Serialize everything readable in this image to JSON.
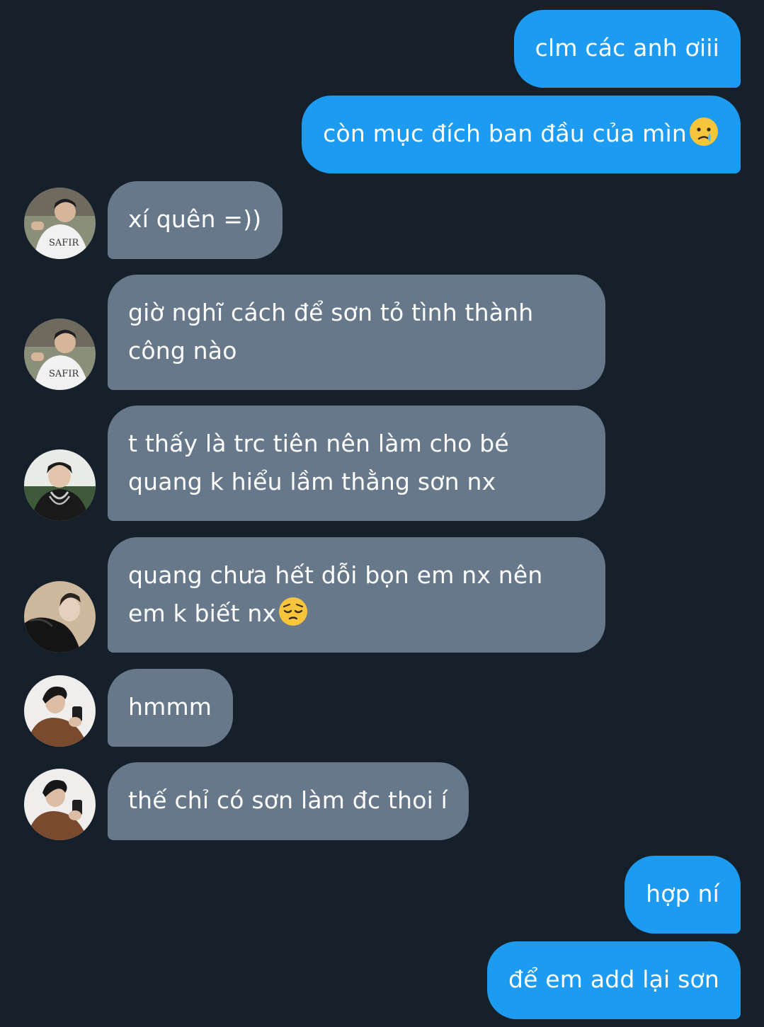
{
  "thread": {
    "messages": [
      {
        "side": "outgoing",
        "text": "clm các anh ơiii"
      },
      {
        "side": "outgoing",
        "text": "còn mục đích ban đầu của mìn",
        "emoji": "crying-face"
      },
      {
        "side": "incoming",
        "avatar": "avatar-white-shirt-guy",
        "text": "xí quên =))"
      },
      {
        "side": "incoming",
        "avatar": "avatar-white-shirt-guy",
        "text": "giờ nghĩ cách để sơn tỏ tình thành công nào"
      },
      {
        "side": "incoming",
        "avatar": "avatar-chain-necklace-guy",
        "text": "t thấy là trc tiên nên làm cho bé quang k hiểu lầm thằng sơn nx"
      },
      {
        "side": "incoming",
        "avatar": "avatar-leather-jacket-guy",
        "text": "quang chưa hết dỗi bọn em nx nên em k biết nx",
        "emoji": "pensive-face"
      },
      {
        "side": "incoming",
        "avatar": "avatar-brown-coat-phone-guy",
        "text": "hmmm"
      },
      {
        "side": "incoming",
        "avatar": "avatar-brown-coat-phone-guy",
        "text": "thế chỉ có sơn làm đc thoi í"
      },
      {
        "side": "outgoing",
        "text": "hợp ní"
      },
      {
        "side": "outgoing",
        "text": "để em add lại sơn"
      }
    ]
  },
  "colors": {
    "background": "#15202b",
    "outgoing_bubble": "#1d9bf0",
    "incoming_bubble": "#66788a",
    "text": "#ffffff"
  }
}
